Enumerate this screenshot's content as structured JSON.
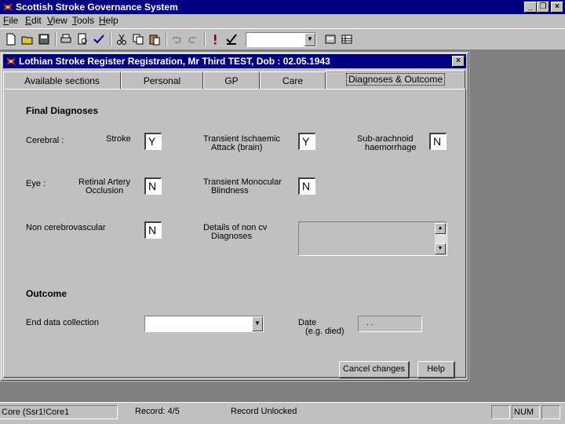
{
  "app": {
    "title": "Scottish Stroke Governance System"
  },
  "menu": [
    {
      "label": "File",
      "accel": "F",
      "rest": "ile"
    },
    {
      "label": "Edit",
      "accel": "E",
      "rest": "dit"
    },
    {
      "label": "View",
      "accel": "V",
      "rest": "iew"
    },
    {
      "label": "Tools",
      "accel": "T",
      "rest": "ools"
    },
    {
      "label": "Help",
      "accel": "H",
      "rest": "elp"
    }
  ],
  "toolbar": {
    "combo_value": ""
  },
  "child": {
    "title": "Lothian Stroke Register   Registration, Mr Third TEST, Dob : 02.05.1943"
  },
  "tabs": [
    "Available sections",
    "Personal",
    "GP",
    "Care",
    "Diagnoses & Outcome"
  ],
  "diagnoses": {
    "heading": "Final Diagnoses",
    "cerebral_label": "Cerebral :",
    "stroke_label": "Stroke",
    "stroke_value": "Y",
    "tia_label_1": "Transient Ischaemic",
    "tia_label_2": "Attack (brain)",
    "tia_value": "Y",
    "sah_label_1": "Sub-arachnoid",
    "sah_label_2": "haemorrhage",
    "sah_value": "N",
    "eye_label": "Eye   :",
    "rao_label_1": "Retinal Artery",
    "rao_label_2": "Occlusion",
    "rao_value": "N",
    "tmb_label_1": "Transient Monocular",
    "tmb_label_2": "Blindness",
    "tmb_value": "N",
    "noncv_label": "Non cerebrovascular",
    "noncv_value": "N",
    "details_label_1": "Details of non cv",
    "details_label_2": "Diagnoses",
    "details_value": ""
  },
  "outcome": {
    "heading": "Outcome",
    "end_label": "End data collection",
    "end_value": "",
    "date_label_1": "Date",
    "date_label_2": "(e.g. died)",
    "date_value": ". ."
  },
  "buttons": {
    "cancel": "Cancel changes",
    "help": "Help"
  },
  "status": {
    "core": "Core (Ssr1!Core1",
    "record": "Record: 4/5",
    "lock": "Record Unlocked",
    "num": "NUM"
  },
  "colors": {
    "titlebar": "#000080",
    "face": "#c0c0c0",
    "mdi": "#808080"
  }
}
